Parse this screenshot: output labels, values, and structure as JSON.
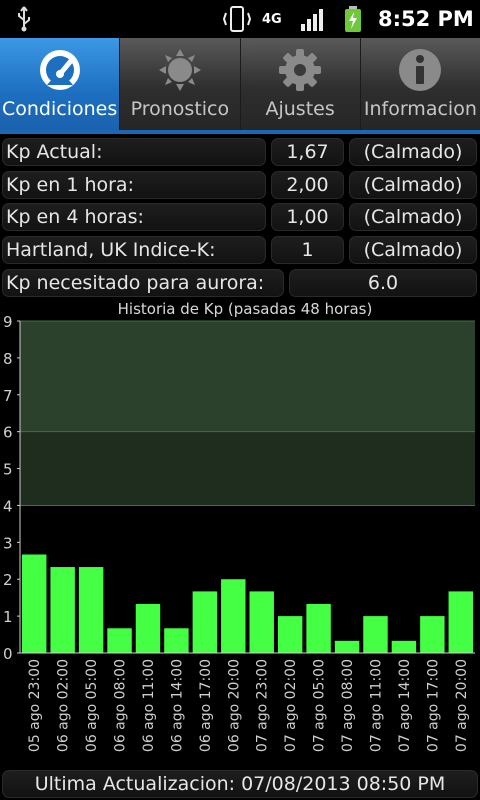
{
  "status_bar": {
    "network": "4G",
    "time": "8:52 PM"
  },
  "tabs": [
    {
      "label": "Condiciones",
      "icon": "gauge-icon",
      "active": true
    },
    {
      "label": "Pronostico",
      "icon": "sun-icon",
      "active": false
    },
    {
      "label": "Ajustes",
      "icon": "gear-icon",
      "active": false
    },
    {
      "label": "Informacion",
      "icon": "info-icon",
      "active": false
    }
  ],
  "rows": [
    {
      "label": "Kp Actual:",
      "value": "1,67",
      "status": "(Calmado)"
    },
    {
      "label": "Kp en 1 hora:",
      "value": "2,00",
      "status": "(Calmado)"
    },
    {
      "label": "Kp en 4 horas:",
      "value": "1,00",
      "status": "(Calmado)"
    },
    {
      "label": "Hartland, UK Indice-K:",
      "value": "1",
      "status": "(Calmado)"
    }
  ],
  "aurora_row": {
    "label": "Kp necesitado para aurora:",
    "value": "6.0"
  },
  "chart_data": {
    "type": "bar",
    "title": "Historia de Kp (pasadas 48 horas)",
    "categories": [
      "05 ago 23:00",
      "06 ago 02:00",
      "06 ago 05:00",
      "06 ago 08:00",
      "06 ago 11:00",
      "06 ago 14:00",
      "06 ago 17:00",
      "06 ago 20:00",
      "07 ago 23:00",
      "07 ago 02:00",
      "07 ago 05:00",
      "07 ago 08:00",
      "07 ago 11:00",
      "07 ago 14:00",
      "07 ago 17:00",
      "07 ago 20:00"
    ],
    "tick_labels": [
      "05 ago 23:00",
      "06 ago 02:00",
      "06 ago 05:00",
      "06 ago 08:00",
      "06 ago 11:00",
      "06 ago 14:00",
      "06 ago 17:00",
      "06 ago 20:00",
      "07 ago 23:00",
      "07 ago 02:00",
      "07 ago 05:00",
      "07 ago 08:00",
      "07 ago 11:00",
      "07 ago 14:00",
      "07 ago 17:00",
      "07 ago 20:00"
    ],
    "values": [
      2.67,
      2.33,
      2.33,
      0.67,
      1.33,
      0.67,
      1.67,
      2.0,
      1.67,
      1.0,
      1.33,
      0.33,
      1.0,
      0.33,
      1.0,
      1.67
    ],
    "ylim": [
      0,
      9
    ],
    "yticks": [
      0,
      1,
      2,
      3,
      4,
      5,
      6,
      7,
      8,
      9
    ],
    "bands": [
      {
        "from": 4,
        "to": 6,
        "color": "#1e2d1e"
      },
      {
        "from": 6,
        "to": 9,
        "color": "#2b412b"
      }
    ],
    "bar_color": "#44ff44",
    "grid": false
  },
  "footer": {
    "text": "Ultima Actualizacion: 07/08/2013 08:50 PM"
  },
  "colors": {
    "accent": "#1d6fc0",
    "bar": "#44ff44"
  }
}
